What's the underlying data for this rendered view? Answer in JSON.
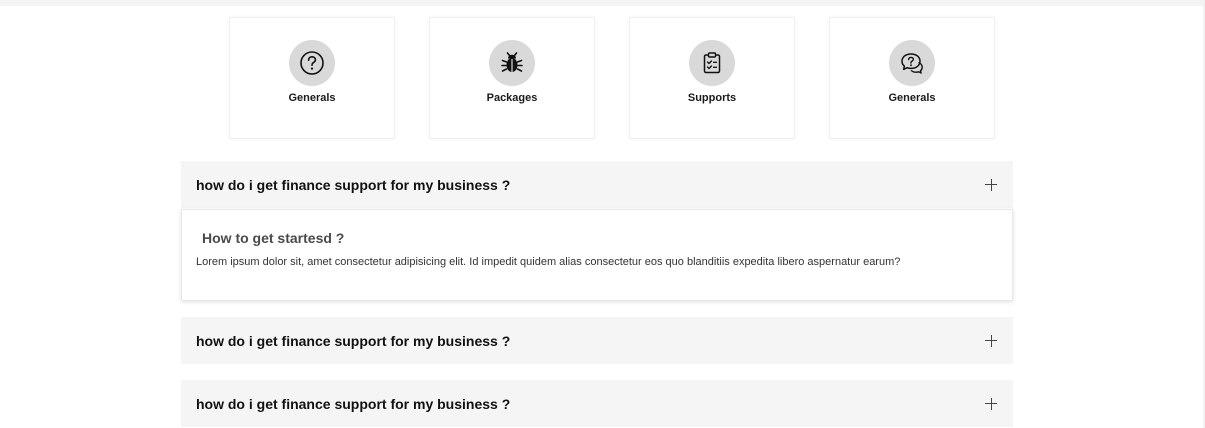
{
  "categories": [
    {
      "label": "Generals",
      "icon": "question-circle-icon"
    },
    {
      "label": "Packages",
      "icon": "bug-icon"
    },
    {
      "label": "Supports",
      "icon": "clipboard-check-icon"
    },
    {
      "label": "Generals",
      "icon": "chat-question-icon"
    }
  ],
  "faqs": [
    {
      "question": "how do i get finance support for my business ?",
      "expanded": false
    },
    {
      "question": "how do i get finance support for my business ?",
      "expanded": false
    },
    {
      "question": "how do i get finance support for my business ?",
      "expanded": false
    }
  ],
  "answer": {
    "title": "How to get startesd ?",
    "text": "Lorem ipsum dolor sit, amet consectetur adipisicing elit. Id impedit quidem alias consectetur eos quo blanditiis expedita libero aspernatur earum?"
  },
  "colors": {
    "icon_circle": "#d9d9d9",
    "accordion_bg": "#f5f5f5"
  }
}
